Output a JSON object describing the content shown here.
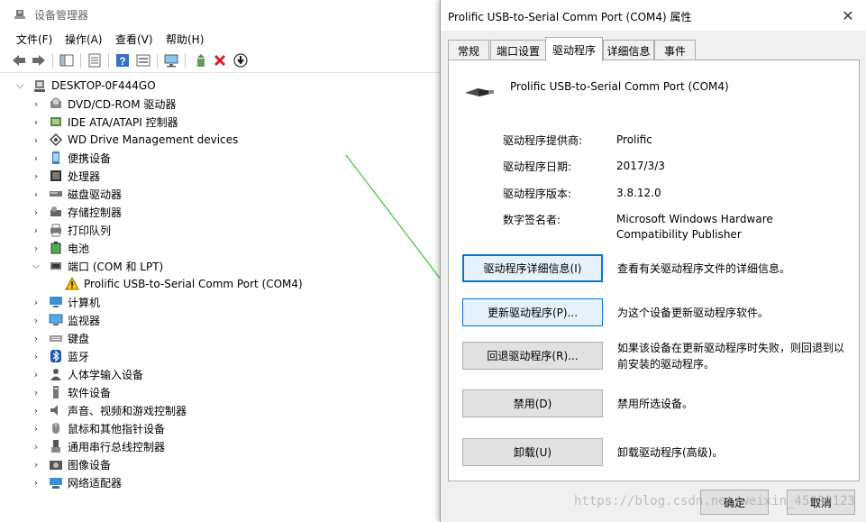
{
  "device_manager": {
    "title": "设备管理器",
    "menu": [
      "文件(F)",
      "操作(A)",
      "查看(V)",
      "帮助(H)"
    ],
    "tree": {
      "root": "DESKTOP-0F444GO",
      "items": [
        {
          "label": "DVD/CD-ROM 驱动器",
          "icon": "dvd-icon",
          "expanded": false
        },
        {
          "label": "IDE ATA/ATAPI 控制器",
          "icon": "ide-controller-icon",
          "expanded": false
        },
        {
          "label": "WD Drive Management devices",
          "icon": "wd-drive-icon",
          "expanded": false
        },
        {
          "label": "便携设备",
          "icon": "portable-device-icon",
          "expanded": false
        },
        {
          "label": "处理器",
          "icon": "processor-icon",
          "expanded": false
        },
        {
          "label": "磁盘驱动器",
          "icon": "disk-drive-icon",
          "expanded": false
        },
        {
          "label": "存储控制器",
          "icon": "storage-controller-icon",
          "expanded": false
        },
        {
          "label": "打印队列",
          "icon": "printer-icon",
          "expanded": false
        },
        {
          "label": "电池",
          "icon": "battery-icon",
          "expanded": false
        },
        {
          "label": "端口 (COM 和 LPT)",
          "icon": "port-icon",
          "expanded": true
        },
        {
          "label": "Prolific USB-to-Serial Comm Port (COM4)",
          "icon": "warning-device-icon",
          "child": true
        },
        {
          "label": "计算机",
          "icon": "computer-icon",
          "expanded": false
        },
        {
          "label": "监视器",
          "icon": "monitor-icon",
          "expanded": false
        },
        {
          "label": "键盘",
          "icon": "keyboard-icon",
          "expanded": false
        },
        {
          "label": "蓝牙",
          "icon": "bluetooth-icon",
          "expanded": false
        },
        {
          "label": "人体学输入设备",
          "icon": "hid-icon",
          "expanded": false
        },
        {
          "label": "软件设备",
          "icon": "software-device-icon",
          "expanded": false
        },
        {
          "label": "声音、视频和游戏控制器",
          "icon": "sound-icon",
          "expanded": false
        },
        {
          "label": "鼠标和其他指针设备",
          "icon": "mouse-icon",
          "expanded": false
        },
        {
          "label": "通用串行总线控制器",
          "icon": "usb-icon",
          "expanded": false
        },
        {
          "label": "图像设备",
          "icon": "camera-icon",
          "expanded": false
        },
        {
          "label": "网络适配器",
          "icon": "network-adapter-icon",
          "expanded": false
        }
      ]
    }
  },
  "dialog": {
    "title": "Prolific USB-to-Serial Comm Port (COM4) 属性",
    "tabs": [
      "常规",
      "端口设置",
      "驱动程序",
      "详细信息",
      "事件"
    ],
    "active_tab": "驱动程序",
    "device_name": "Prolific USB-to-Serial Comm Port (COM4)",
    "info": [
      {
        "key": "驱动程序提供商:",
        "value": "Prolific"
      },
      {
        "key": "驱动程序日期:",
        "value": "2017/3/3"
      },
      {
        "key": "驱动程序版本:",
        "value": "3.8.12.0"
      },
      {
        "key": "数字签名者:",
        "value": "Microsoft Windows Hardware Compatibility Publisher"
      }
    ],
    "actions": [
      {
        "button": "驱动程序详细信息(I)",
        "desc": "查看有关驱动程序文件的详细信息。"
      },
      {
        "button": "更新驱动程序(P)...",
        "desc": "为这个设备更新驱动程序软件。"
      },
      {
        "button": "回退驱动程序(R)...",
        "desc": "如果该设备在更新驱动程序时失败，则回退到以前安装的驱动程序。"
      },
      {
        "button": "禁用(D)",
        "desc": "禁用所选设备。"
      },
      {
        "button": "卸载(U)",
        "desc": "卸载驱动程序(高级)。"
      }
    ],
    "ok": "确定",
    "cancel": "取消",
    "watermark": "https://blog.csdn.net/weixin_45000123"
  },
  "colors": {
    "accent": "#0078d7",
    "arrow": "#33cc33",
    "warning": "#e8b400"
  }
}
